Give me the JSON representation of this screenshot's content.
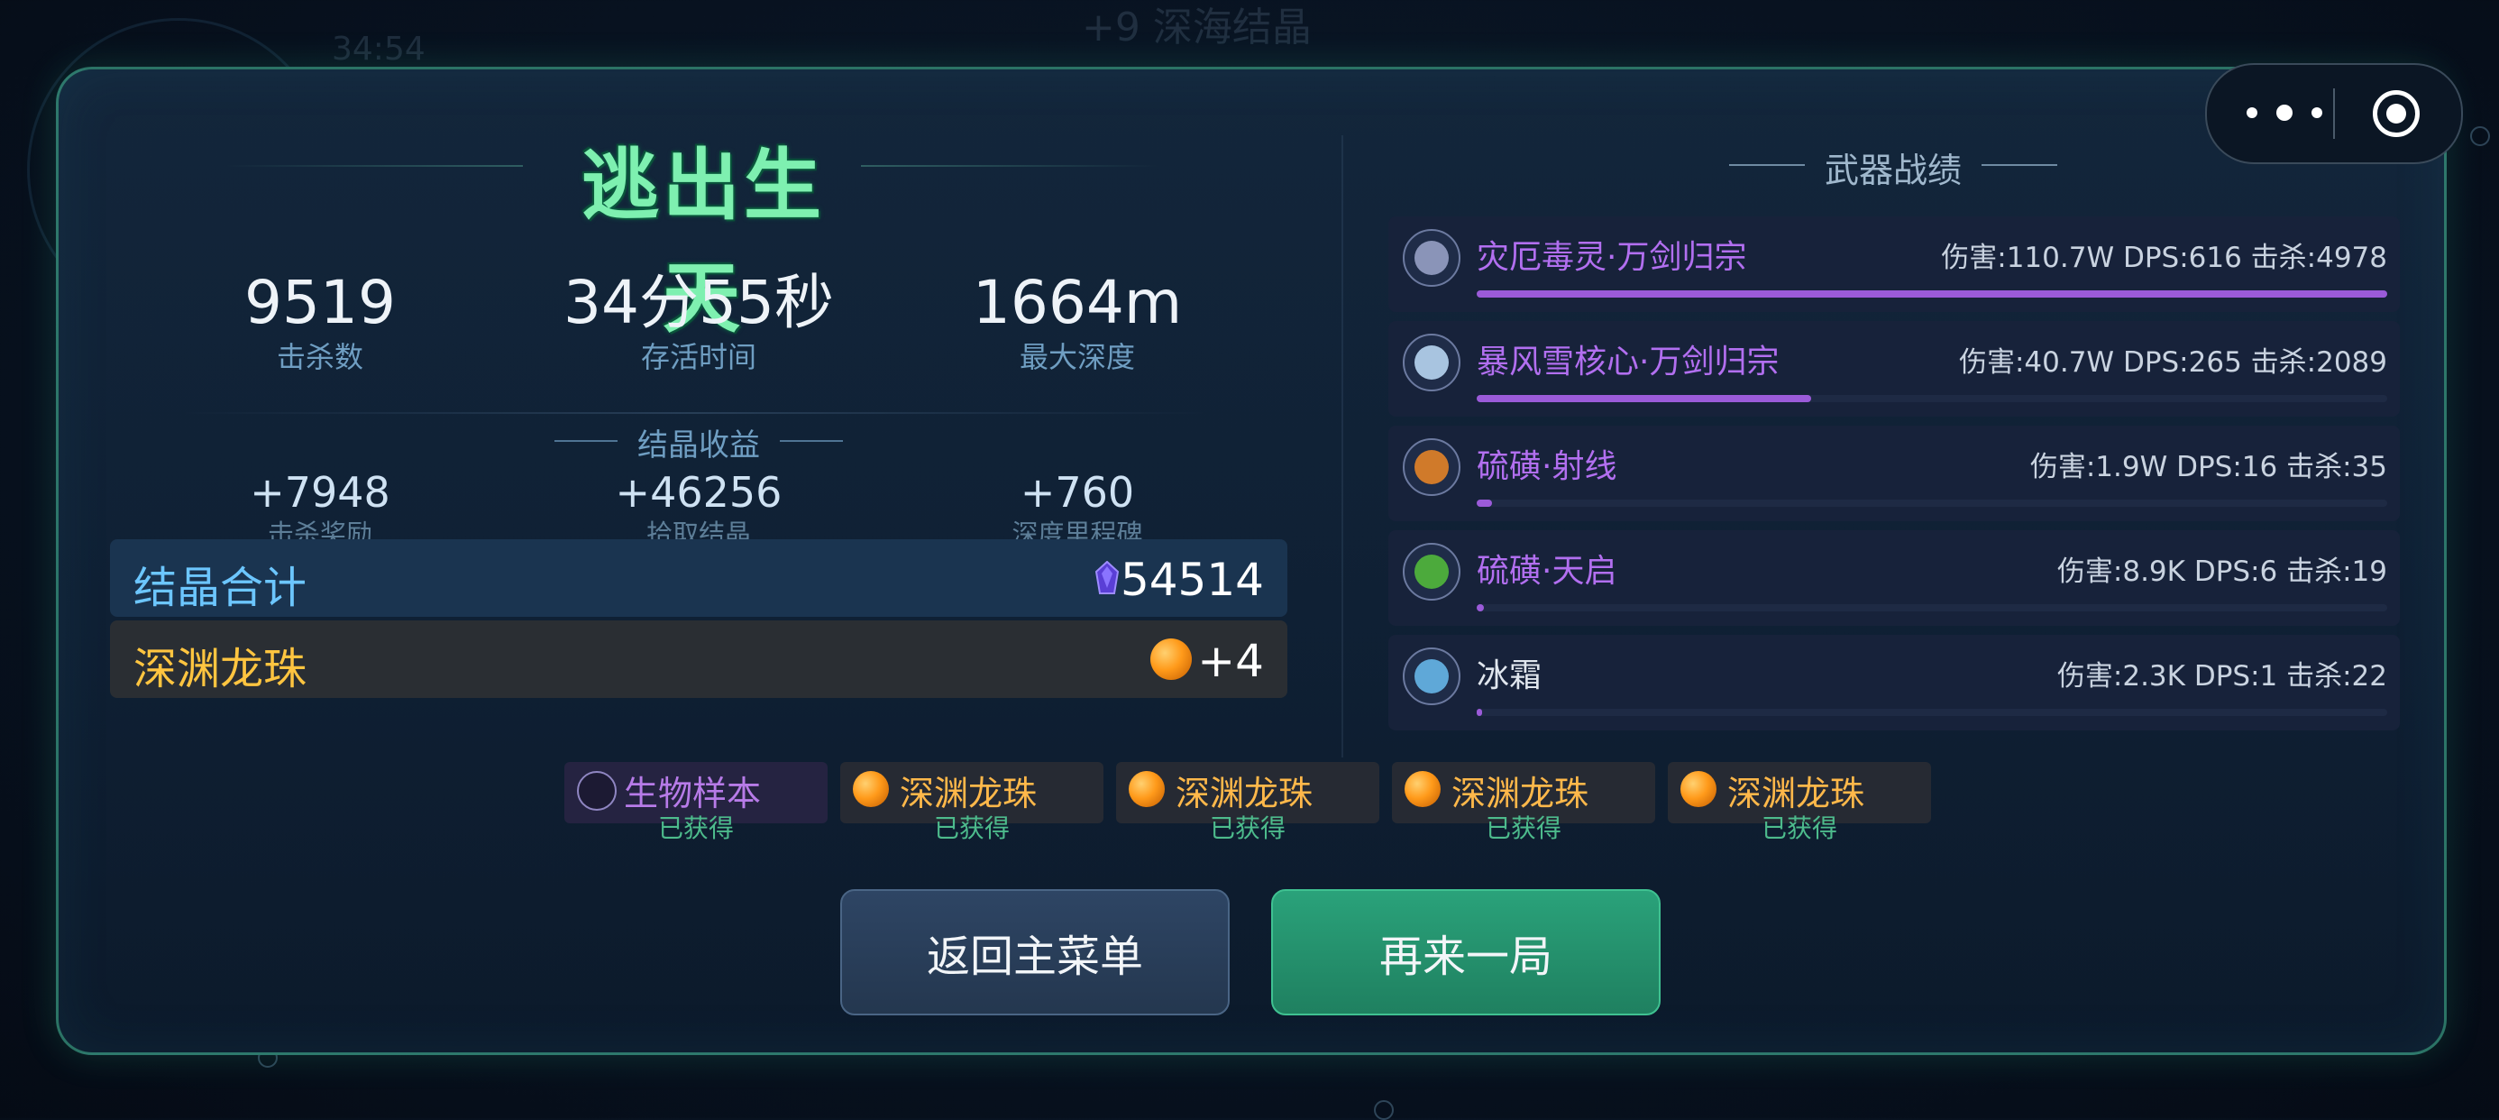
{
  "background": {
    "ghost_timer": "34:54",
    "ghost_line1": "+9 深海结晶",
    "ghost_line2": "+9 深海结晶"
  },
  "result": {
    "title": "逃出生天",
    "stats": [
      {
        "value": "9519",
        "label": "击杀数"
      },
      {
        "value": "34分55秒",
        "label": "存活时间"
      },
      {
        "value": "1664m",
        "label": "最大深度"
      }
    ],
    "crystal_section_title": "结晶收益",
    "crystal_gains": [
      {
        "value": "+7948",
        "label": "击杀奖励"
      },
      {
        "value": "+46256",
        "label": "拾取结晶"
      },
      {
        "value": "+760",
        "label": "深度里程碑"
      }
    ],
    "crystal_total": {
      "label": "结晶合计",
      "value": "54514"
    },
    "dragon_orb": {
      "label": "深渊龙珠",
      "value": "+4"
    }
  },
  "weapons": {
    "title": "武器战绩",
    "items": [
      {
        "name": "灾厄毒灵·万剑归宗",
        "stats": "伤害:110.7W DPS:616 击杀:4978",
        "progress": 1.0,
        "name_color": "#b26ff0",
        "icon_color": "#8a94b8"
      },
      {
        "name": "暴风雪核心·万剑归宗",
        "stats": "伤害:40.7W DPS:265 击杀:2089",
        "progress": 0.367,
        "name_color": "#b26ff0",
        "icon_color": "#a8c4e0"
      },
      {
        "name": "硫磺·射线",
        "stats": "伤害:1.9W DPS:16 击杀:35",
        "progress": 0.017,
        "name_color": "#b26ff0",
        "icon_color": "#d07a2a"
      },
      {
        "name": "硫磺·天启",
        "stats": "伤害:8.9K DPS:6 击杀:19",
        "progress": 0.008,
        "name_color": "#b26ff0",
        "icon_color": "#4caa3c"
      },
      {
        "name": "冰霜",
        "stats": "伤害:2.3K DPS:1 击杀:22",
        "progress": 0.005,
        "name_color": "#e0e6ee",
        "icon_color": "#5fa8d8"
      }
    ]
  },
  "rewards": [
    {
      "name": "生物样本",
      "status": "已获得",
      "type": "bio"
    },
    {
      "name": "深渊龙珠",
      "status": "已获得",
      "type": "orb"
    },
    {
      "name": "深渊龙珠",
      "status": "已获得",
      "type": "orb"
    },
    {
      "name": "深渊龙珠",
      "status": "已获得",
      "type": "orb"
    },
    {
      "name": "深渊龙珠",
      "status": "已获得",
      "type": "orb"
    }
  ],
  "buttons": {
    "back": "返回主菜单",
    "again": "再来一局"
  },
  "capsule": {
    "menu_icon": "more-dots-icon",
    "close_icon": "target-close-icon"
  }
}
